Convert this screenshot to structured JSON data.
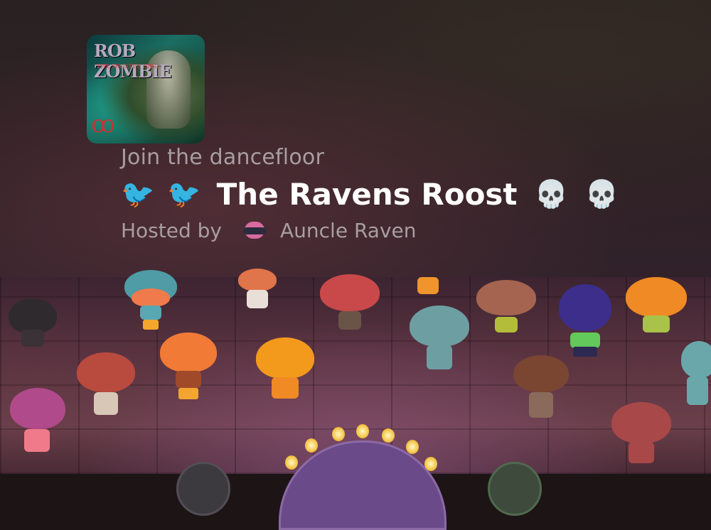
{
  "header": {
    "album_logo": "ROB ZOMBIE",
    "album_subtitle": "THE SINISTER URGE",
    "subtitle": "Join the dancefloor",
    "room_name": "The Ravens Roost",
    "left_emojis": [
      "🐦",
      "🐦"
    ],
    "right_emojis": [
      "💀",
      "💀"
    ],
    "hosted_by_label": "Hosted by",
    "host_name": "Auncle Raven"
  },
  "dancefloor": {
    "center_control_icon": "bulb-dial",
    "left_button_icon": "red-button",
    "right_button_icon": "green-button"
  }
}
